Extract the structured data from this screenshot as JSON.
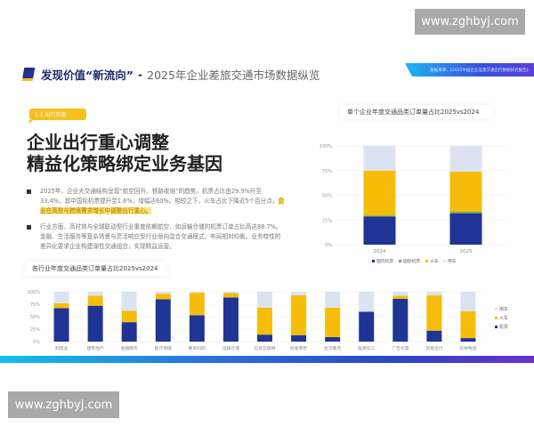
{
  "watermark": "www.zghbyj.com",
  "header": {
    "title_bold": "发现价值“新流向”",
    "dash": "-",
    "title_light": "2025年企业差旅交通市场数据纵览",
    "source": "数据来源：《2025中国企业差旅交通出行数据研究报告》"
  },
  "section_tag": "1.1 出行热度",
  "headline": [
    "企业出行重心调整",
    "精益化策略绑定业务基因"
  ],
  "bullets": [
    {
      "text": "2025年，企业大交通结构呈现“航空回升、铁路收缩”的趋势。机票占比由29.9%升至33.4%，其中国际机票提升至1.6%，增幅达60%。相较之下，火车占比下降近5个百分点，",
      "highlight": "企业在高效与跨境需求增长中调整出行重心。"
    },
    {
      "text": "行业方面，高时效与全球联动型行业重度依赖航空，如运输仓储的机票订单占比高达88.7%。金融、生活服务等复杂场景与灵活响应型行业倾向混合交通模式，布局相对均衡。业务特性的差异化要求企业构建弹性交通组合，实现精益运营。",
      "highlight": ""
    }
  ],
  "colors": {
    "domestic_air": "#1f3494",
    "intl_air": "#6fb04a",
    "train": "#f5bd0a",
    "bus": "#dce3f0",
    "accent": "#f5c020"
  },
  "chart_data": [
    {
      "type": "bar",
      "stacked": true,
      "title": "单个企业年度交通品类订单量占比2025vs2024",
      "categories": [
        "2024",
        "2025"
      ],
      "yticks": [
        "0%",
        "25%",
        "50%",
        "75%",
        "100%"
      ],
      "ylim": [
        0,
        100
      ],
      "series": [
        {
          "name": "国内机票",
          "values": [
            28.5,
            31.8
          ],
          "color": "#1f3494"
        },
        {
          "name": "国际机票",
          "values": [
            1.0,
            1.6
          ],
          "color": "#6fb04a"
        },
        {
          "name": "火车",
          "values": [
            45.5,
            40.6
          ],
          "color": "#f5bd0a"
        },
        {
          "name": "用车",
          "values": [
            25.0,
            26.0
          ],
          "color": "#dce3f0"
        }
      ],
      "legend": "bottom"
    },
    {
      "type": "bar",
      "stacked": true,
      "title": "各行业年度交通品类订单量占比2025vs2024",
      "categories": [
        "制造业",
        "建筑地产",
        "金融服务",
        "医疗保健",
        "教育科研",
        "运输仓储",
        "信息互联网",
        "批发零售",
        "生活服务",
        "能源化工",
        "广告文旅",
        "贸易出行",
        "农林牧渔"
      ],
      "yticks": [
        "0%",
        "25%",
        "50%",
        "75%",
        "100%"
      ],
      "ylim": [
        0,
        100
      ],
      "series": [
        {
          "name": "机票",
          "values": [
            67,
            72,
            39,
            85,
            53,
            88.7,
            14,
            13,
            9,
            60,
            86,
            22,
            7
          ],
          "color": "#1f3494"
        },
        {
          "name": "火车",
          "values": [
            10,
            20,
            23,
            11,
            45,
            9,
            54,
            80,
            59,
            0,
            6,
            71,
            54
          ],
          "color": "#f5bd0a"
        },
        {
          "name": "用车",
          "values": [
            23,
            8,
            38,
            4,
            2,
            2.3,
            32,
            7,
            32,
            40,
            8,
            7,
            39
          ],
          "color": "#dce3f0"
        }
      ],
      "legend": "right"
    }
  ]
}
